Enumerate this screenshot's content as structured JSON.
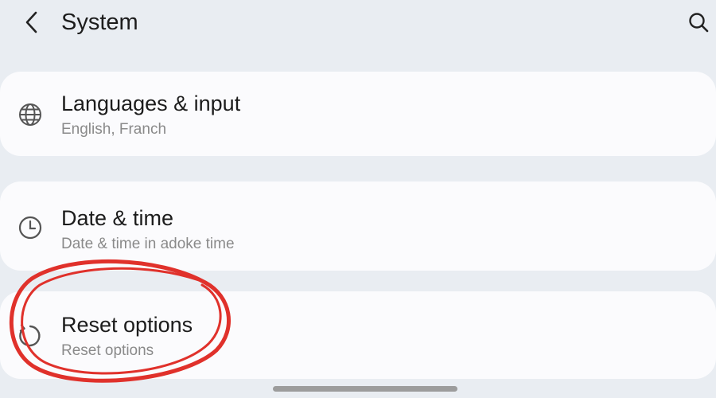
{
  "header": {
    "title": "System",
    "back_icon": "back-arrow-icon",
    "search_icon": "search-icon"
  },
  "items": [
    {
      "icon": "globe-icon",
      "title": "Languages & input",
      "subtitle": "English, Franch"
    },
    {
      "icon": "clock-icon",
      "title": "Date & time",
      "subtitle": "Date & time in adoke time"
    },
    {
      "icon": "reset-icon",
      "title": "Reset options",
      "subtitle": "Reset options"
    }
  ],
  "colors": {
    "background": "#e9edf2",
    "card": "#fbfbfd",
    "annotation": "#e0312b"
  }
}
